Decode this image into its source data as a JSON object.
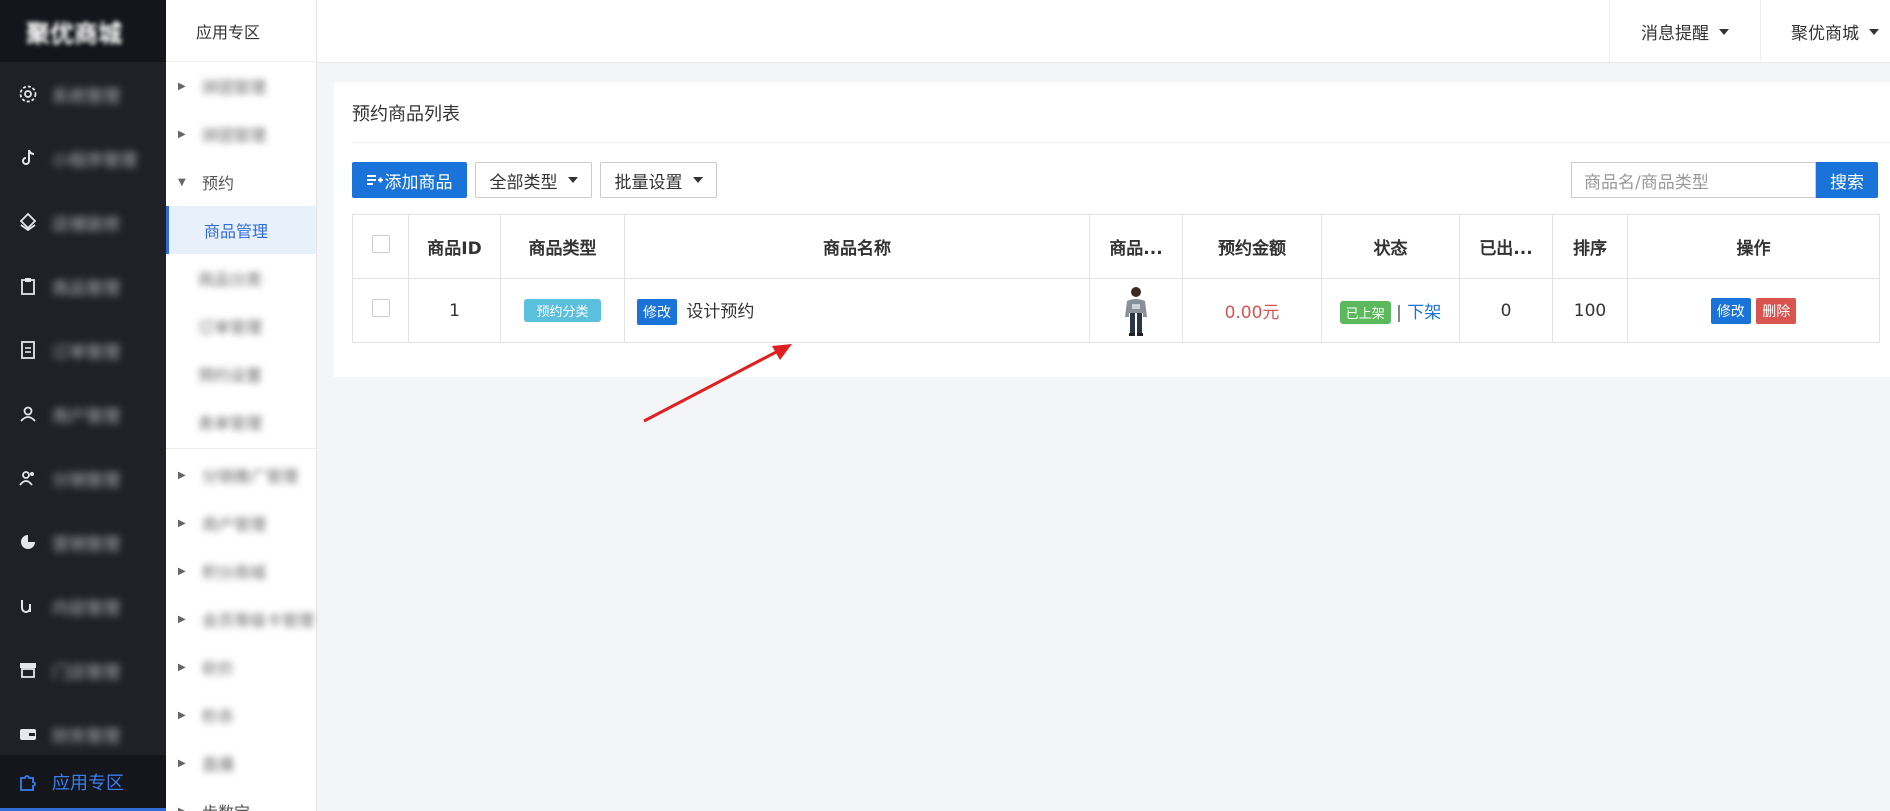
{
  "nav": {
    "logo": "聚优商城",
    "items": [
      {
        "icon": "gear-icon",
        "label": "系统管理"
      },
      {
        "icon": "tiktok-icon",
        "label": "小程序管理"
      },
      {
        "icon": "layers-icon",
        "label": "店铺装修"
      },
      {
        "icon": "clipboard-icon",
        "label": "商品管理"
      },
      {
        "icon": "document-icon",
        "label": "订单管理"
      },
      {
        "icon": "user-icon",
        "label": "用户管理"
      },
      {
        "icon": "users-icon",
        "label": "分销管理"
      },
      {
        "icon": "chart-icon",
        "label": "营销管理"
      },
      {
        "icon": "link-icon",
        "label": "内容管理"
      },
      {
        "icon": "store-icon",
        "label": "门店管理"
      },
      {
        "icon": "wallet-icon",
        "label": "财务管理"
      }
    ],
    "active": {
      "icon": "puzzle-icon",
      "label": "应用专区"
    }
  },
  "subnav": {
    "header": "应用专区",
    "items": [
      {
        "label": "拼团管理",
        "type": "collapsed",
        "blur": true
      },
      {
        "label": "拼团管理",
        "type": "collapsed",
        "blur": true
      },
      {
        "label": "预约",
        "type": "expanded"
      },
      {
        "label": "商品管理",
        "type": "selected"
      },
      {
        "label": "商品分类",
        "type": "child",
        "blur": true
      },
      {
        "label": "订单管理",
        "type": "child",
        "blur": true
      },
      {
        "label": "预约设置",
        "type": "child",
        "blur": true
      },
      {
        "label": "表单管理",
        "type": "child",
        "blur": true
      },
      {
        "label": "分销推广管理",
        "type": "collapsed",
        "blur": true,
        "sep": true
      },
      {
        "label": "商户管理",
        "type": "collapsed",
        "blur": true
      },
      {
        "label": "积分商城",
        "type": "collapsed",
        "blur": true
      },
      {
        "label": "会员等级卡管理",
        "type": "collapsed",
        "blur": true
      },
      {
        "label": "砍价",
        "type": "collapsed",
        "blur": true
      },
      {
        "label": "秒杀",
        "type": "collapsed",
        "blur": true
      },
      {
        "label": "直播",
        "type": "collapsed",
        "blur": true
      },
      {
        "label": "步数宝",
        "type": "collapsed"
      }
    ]
  },
  "header": {
    "messages": "消息提醒",
    "account": "聚优商城"
  },
  "page": {
    "title": "预约商品列表",
    "add_button": "添加商品",
    "type_filter": "全部类型",
    "batch_settings": "批量设置",
    "search_placeholder": "商品名/商品类型",
    "search_button": "搜索"
  },
  "table": {
    "columns": [
      "商品ID",
      "商品类型",
      "商品名称",
      "商品...",
      "预约金额",
      "状态",
      "已出...",
      "排序",
      "操作"
    ],
    "rows": [
      {
        "id": "1",
        "type": "预约分类",
        "edit_label": "修改",
        "name": "设计预约",
        "price": "0.00元",
        "status": "已上架",
        "status_action": "下架",
        "sold": "0",
        "sort": "100",
        "action_edit": "修改",
        "action_delete": "删除"
      }
    ]
  },
  "colors": {
    "primary": "#1a73d9",
    "danger": "#d9534f",
    "success": "#5cb85c",
    "info": "#5bc0de",
    "annotation_arrow": "#e02020"
  }
}
